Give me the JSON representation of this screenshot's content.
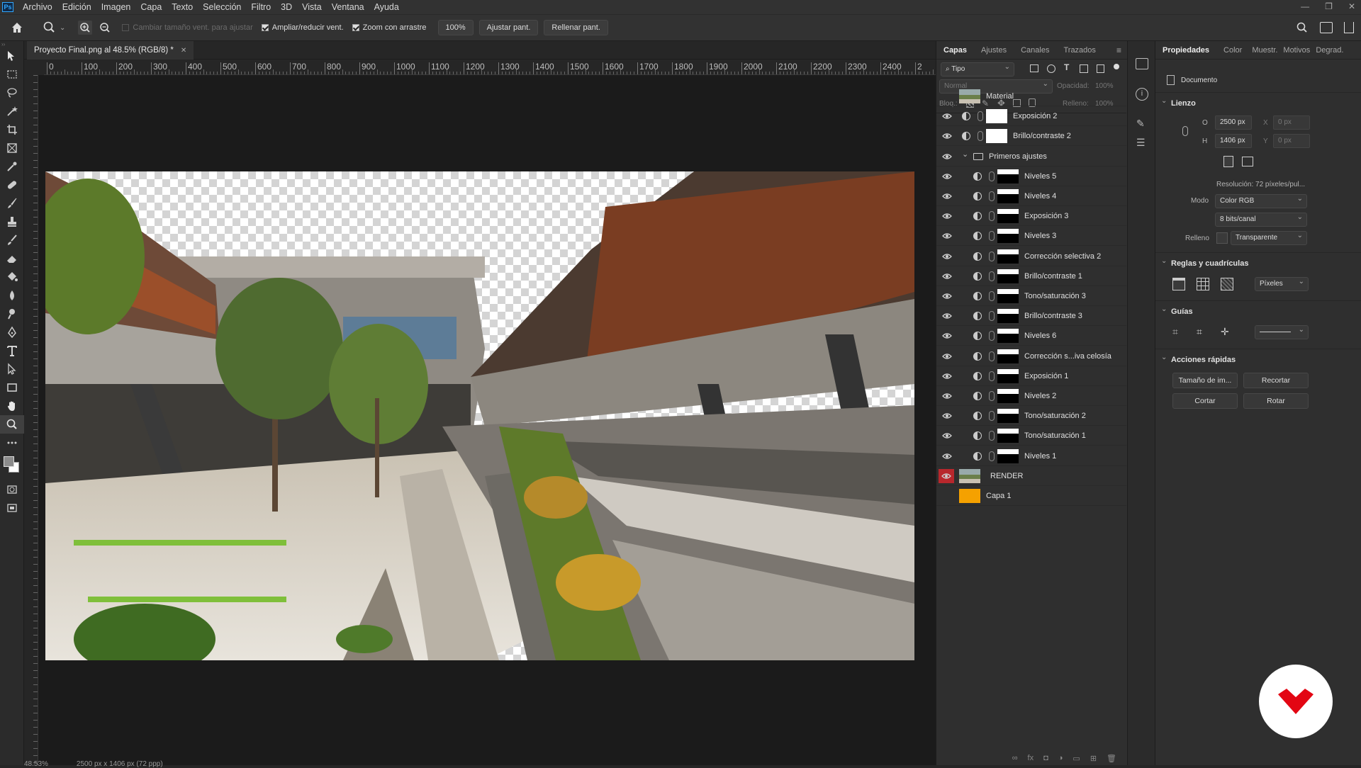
{
  "menu": {
    "app_icon": "Ps",
    "items": [
      "Archivo",
      "Edición",
      "Imagen",
      "Capa",
      "Texto",
      "Selección",
      "Filtro",
      "3D",
      "Vista",
      "Ventana",
      "Ayuda"
    ]
  },
  "options": {
    "resize_windows": "Cambiar tamaño vent. para ajustar",
    "zoom_all": "Ampliar/reducir vent.",
    "scrubby_zoom": "Zoom con arrastre",
    "zoom_value": "100%",
    "fit_screen": "Ajustar pant.",
    "fill_screen": "Rellenar pant."
  },
  "document": {
    "tab_title": "Proyecto Final.png al 48.5% (RGB/8) *",
    "zoom_status": "48.53%",
    "size_status": "2500 px x 1406 px (72 ppp)"
  },
  "ruler": {
    "h_ticks": [
      "0",
      "100",
      "200",
      "300",
      "400",
      "500",
      "600",
      "700",
      "800",
      "900",
      "1000",
      "1100",
      "1200",
      "1300",
      "1400",
      "1500",
      "1600",
      "1700",
      "1800",
      "1900",
      "2000",
      "2100",
      "2200",
      "2300",
      "2400",
      "2"
    ]
  },
  "layers_panel": {
    "tabs": [
      "Capas",
      "Ajustes",
      "Canales",
      "Trazados"
    ],
    "filter_kind": "Tipo",
    "blend_mode": "Normal",
    "opacity_label": "Opacidad:",
    "opacity_value": "100%",
    "lock_label": "Bloq.:",
    "fill_label": "Relleno:",
    "fill_value": "100%",
    "layers": [
      {
        "name": "Material",
        "visible": false,
        "type": "image",
        "indent": 0
      },
      {
        "name": "Exposición 2",
        "visible": true,
        "type": "adjust",
        "indent": 0
      },
      {
        "name": "Brillo/contraste 2",
        "visible": true,
        "type": "adjust",
        "indent": 0
      },
      {
        "name": "Primeros ajustes",
        "visible": true,
        "type": "group",
        "indent": 0
      },
      {
        "name": "Niveles 5",
        "visible": true,
        "type": "adjust",
        "indent": 1
      },
      {
        "name": "Niveles 4",
        "visible": true,
        "type": "adjust",
        "indent": 1
      },
      {
        "name": "Exposición 3",
        "visible": true,
        "type": "adjust",
        "indent": 1
      },
      {
        "name": "Niveles 3",
        "visible": true,
        "type": "adjust",
        "indent": 1
      },
      {
        "name": "Corrección selectiva 2",
        "visible": true,
        "type": "adjust",
        "indent": 1
      },
      {
        "name": "Brillo/contraste 1",
        "visible": true,
        "type": "adjust",
        "indent": 1
      },
      {
        "name": "Tono/saturación 3",
        "visible": true,
        "type": "adjust",
        "indent": 1
      },
      {
        "name": "Brillo/contraste 3",
        "visible": true,
        "type": "adjust",
        "indent": 1
      },
      {
        "name": "Niveles 6",
        "visible": true,
        "type": "adjust",
        "indent": 1
      },
      {
        "name": "Corrección s...iva celosía",
        "visible": true,
        "type": "adjust",
        "indent": 1
      },
      {
        "name": "Exposición 1",
        "visible": true,
        "type": "adjust",
        "indent": 1
      },
      {
        "name": "Niveles 2",
        "visible": true,
        "type": "adjust",
        "indent": 1
      },
      {
        "name": "Tono/saturación 2",
        "visible": true,
        "type": "adjust",
        "indent": 1
      },
      {
        "name": "Tono/saturación 1",
        "visible": true,
        "type": "adjust",
        "indent": 1
      },
      {
        "name": "Niveles 1",
        "visible": true,
        "type": "adjust",
        "indent": 1
      },
      {
        "name": "RENDER",
        "visible": true,
        "type": "image",
        "indent": 0,
        "highlight": true
      },
      {
        "name": "Capa 1",
        "visible": false,
        "type": "fill",
        "indent": 0
      }
    ]
  },
  "properties": {
    "tabs": [
      "Propiedades",
      "Color",
      "Muestr.",
      "Motivos",
      "Degrad."
    ],
    "doc_label": "Documento",
    "canvas": {
      "title": "Lienzo",
      "w_label": "O",
      "w": "2500 px",
      "h_label": "H",
      "h": "1406 px",
      "x_label": "X",
      "x": "0 px",
      "y_label": "Y",
      "y": "0 px",
      "resolution": "Resolución: 72 píxeles/pul...",
      "mode_label": "Modo",
      "mode": "Color RGB",
      "depth": "8 bits/canal",
      "fill_label": "Relleno",
      "fill": "Transparente"
    },
    "rulers": {
      "title": "Reglas y cuadrículas",
      "units": "Píxeles"
    },
    "guides": {
      "title": "Guías"
    },
    "quick": {
      "title": "Acciones rápidas",
      "buttons": [
        "Tamaño de im...",
        "Recortar",
        "Cortar",
        "Rotar"
      ]
    }
  },
  "colors": {
    "accent_red": "#e30613",
    "capa1_fill": "#f5a100",
    "render_eye_bg": "#b8272c"
  }
}
